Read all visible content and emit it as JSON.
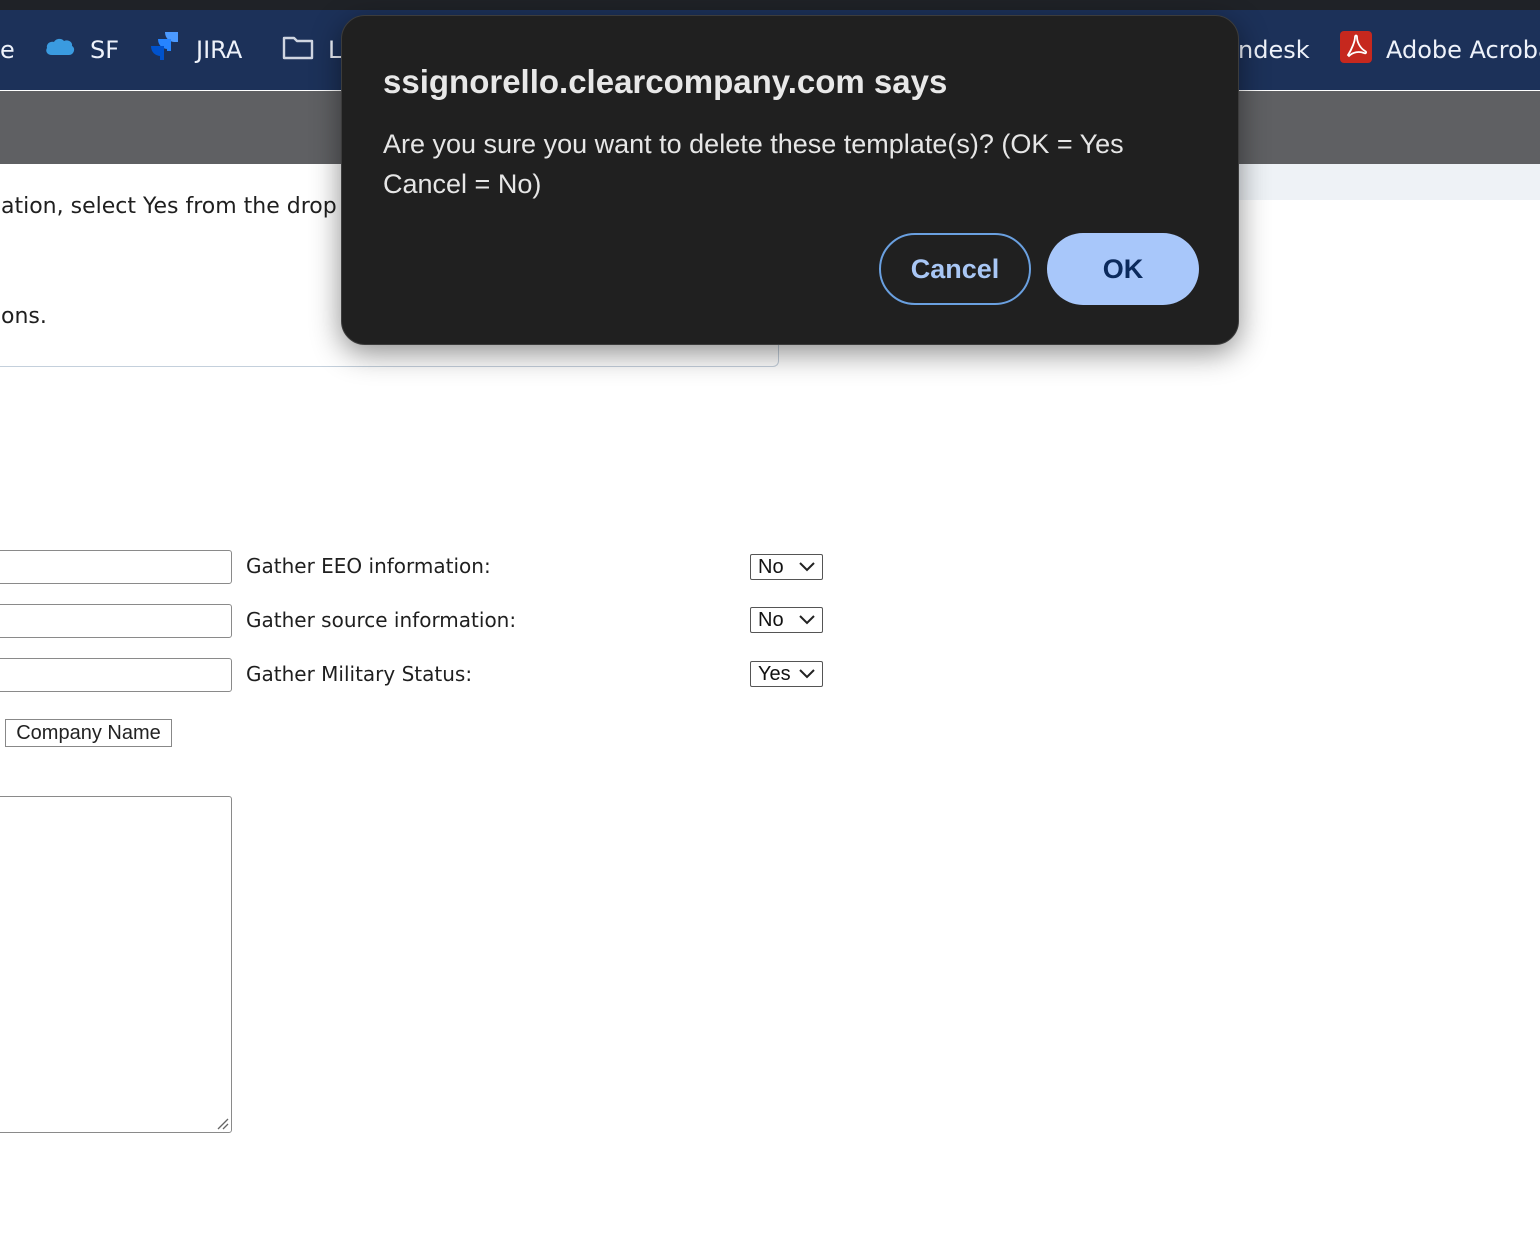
{
  "bookmarks": {
    "items": [
      {
        "label": "e",
        "icon": "none"
      },
      {
        "label": "SF",
        "icon": "salesforce-cloud-icon"
      },
      {
        "label": "JIRA",
        "icon": "jira-icon"
      },
      {
        "label": "L",
        "icon": "folder-icon"
      },
      {
        "label": "ndesk",
        "icon": "none"
      },
      {
        "label": "Adobe Acroba",
        "icon": "adobe-acrobat-icon"
      }
    ]
  },
  "instructions": {
    "line1": "ation, select Yes from the drop",
    "line2": "ons."
  },
  "form": {
    "rows": [
      {
        "label": "Gather EEO information:",
        "value": "No"
      },
      {
        "label": "Gather source information:",
        "value": "No"
      },
      {
        "label": "Gather Military Status:",
        "value": "Yes"
      }
    ],
    "merge_button": "Company Name"
  },
  "dialog": {
    "title": "ssignorello.clearcompany.com says",
    "message_line1": "Are you sure you want to delete these template(s)? (OK = Yes",
    "message_line2": "Cancel = No)",
    "cancel_label": "Cancel",
    "ok_label": "OK"
  },
  "colors": {
    "bookmarks_bg": "#1c3159",
    "header_bg": "#5f6063",
    "dialog_bg": "#202020",
    "ok_button": "#a8c7fa"
  }
}
